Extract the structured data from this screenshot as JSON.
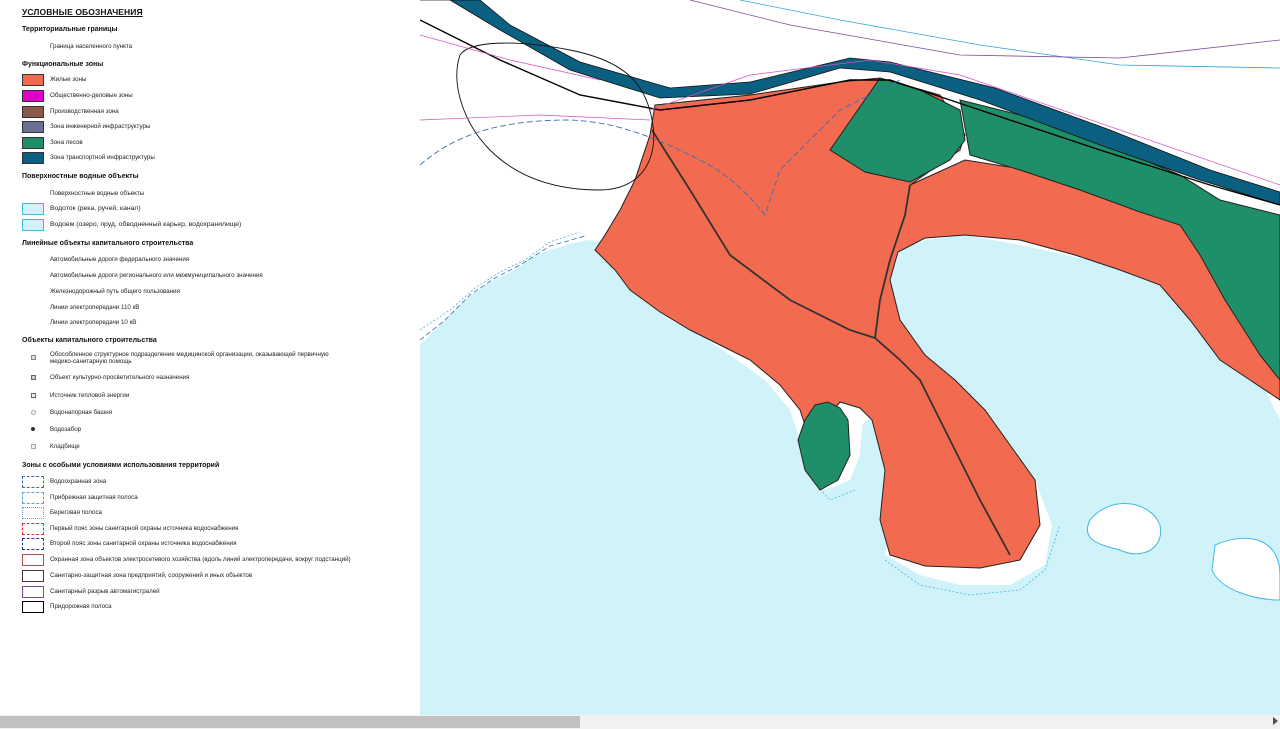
{
  "legend": {
    "title": "УСЛОВНЫЕ ОБОЗНАЧЕНИЯ",
    "sections": {
      "territorial": {
        "title": "Территориальные границы",
        "items": [
          {
            "label": "Граница населенного пункта"
          }
        ]
      },
      "functional": {
        "title": "Функциональные зоны",
        "items": [
          {
            "label": "Жилые зоны",
            "color": "#f26a50"
          },
          {
            "label": "Общественно-деловые зоны",
            "color": "#e000c8"
          },
          {
            "label": "Производственная зона",
            "color": "#8b5a4a"
          },
          {
            "label": "Зона инженерной инфраструктуры",
            "color": "#6b6f93"
          },
          {
            "label": "Зона лесов",
            "color": "#1f8f69"
          },
          {
            "label": "Зона транспортной инфраструктуры",
            "color": "#0b5f80"
          }
        ]
      },
      "water": {
        "title": "Поверхностные водные объекты",
        "items": [
          {
            "label": "Поверхностные водные объекты",
            "color": "#44b6e6"
          },
          {
            "label": "Водоток (река, ручей, канал)",
            "color": "#cff3f8"
          },
          {
            "label": "Водоем (озеро, пруд, обводненный карьер, водохранилище)",
            "color": "#cff3f8"
          }
        ]
      },
      "linear": {
        "title": "Линейные объекты капитального строительства",
        "items": [
          {
            "label": "Автомобильные дороги федерального значения",
            "color": "#000000"
          },
          {
            "label": "Автомобильные дороги регионального или межмуниципального значения",
            "color": "#000000"
          },
          {
            "label": "Железнодорожный путь общего пользования",
            "color": "#000000"
          },
          {
            "label": "Линии электропередачи 110 кВ",
            "color": "#3aa3d8"
          },
          {
            "label": "Линии электропередачи 10 кВ",
            "color": "#d84fc0"
          }
        ]
      },
      "objects": {
        "title": "Объекты капитального строительства",
        "items": [
          {
            "label": "Обособленное структурное подразделение медицинской организации, оказывающей первичную медико-санитарную помощь"
          },
          {
            "label": "Объект культурно-просветительного назначения"
          },
          {
            "label": "Источник тепловой энергии"
          },
          {
            "label": "Водонапорная башня"
          },
          {
            "label": "Водозабор"
          },
          {
            "label": "Кладбище"
          }
        ]
      },
      "special": {
        "title": "Зоны с особыми условиями использования территорий",
        "items": [
          {
            "label": "Водоохранная зона",
            "color": "#3a6fb0"
          },
          {
            "label": "Прибрежная защитная полоса",
            "color": "#5aa0d8"
          },
          {
            "label": "Береговая полоса",
            "color": "#5aa0d8"
          },
          {
            "label": "Первый пояс зоны санитарной охраны источника водоснабжения",
            "color": "#e03030"
          },
          {
            "label": "Второй пояс зоны санитарной охраны источника водоснабжения",
            "color": "#2040a0"
          },
          {
            "label": "Охранная зона объектов электросетевого хозяйства (вдоль линий электропередачи, вокруг подстанций)",
            "color": "#b05050"
          },
          {
            "label": "Санитарно-защитная зона предприятий, сооружений и иных объектов",
            "color": "#503040"
          },
          {
            "label": "Санитарный разрыв автомагистралей",
            "color": "#7a4a9a"
          },
          {
            "label": "Придорожная полоса",
            "color": "#000000"
          }
        ]
      }
    }
  },
  "map": {
    "colors": {
      "residential": "#f26a50",
      "forest": "#1f8f69",
      "transport": "#0b5f80",
      "water": "#cff3f8",
      "waterline": "#44b6e6"
    }
  }
}
